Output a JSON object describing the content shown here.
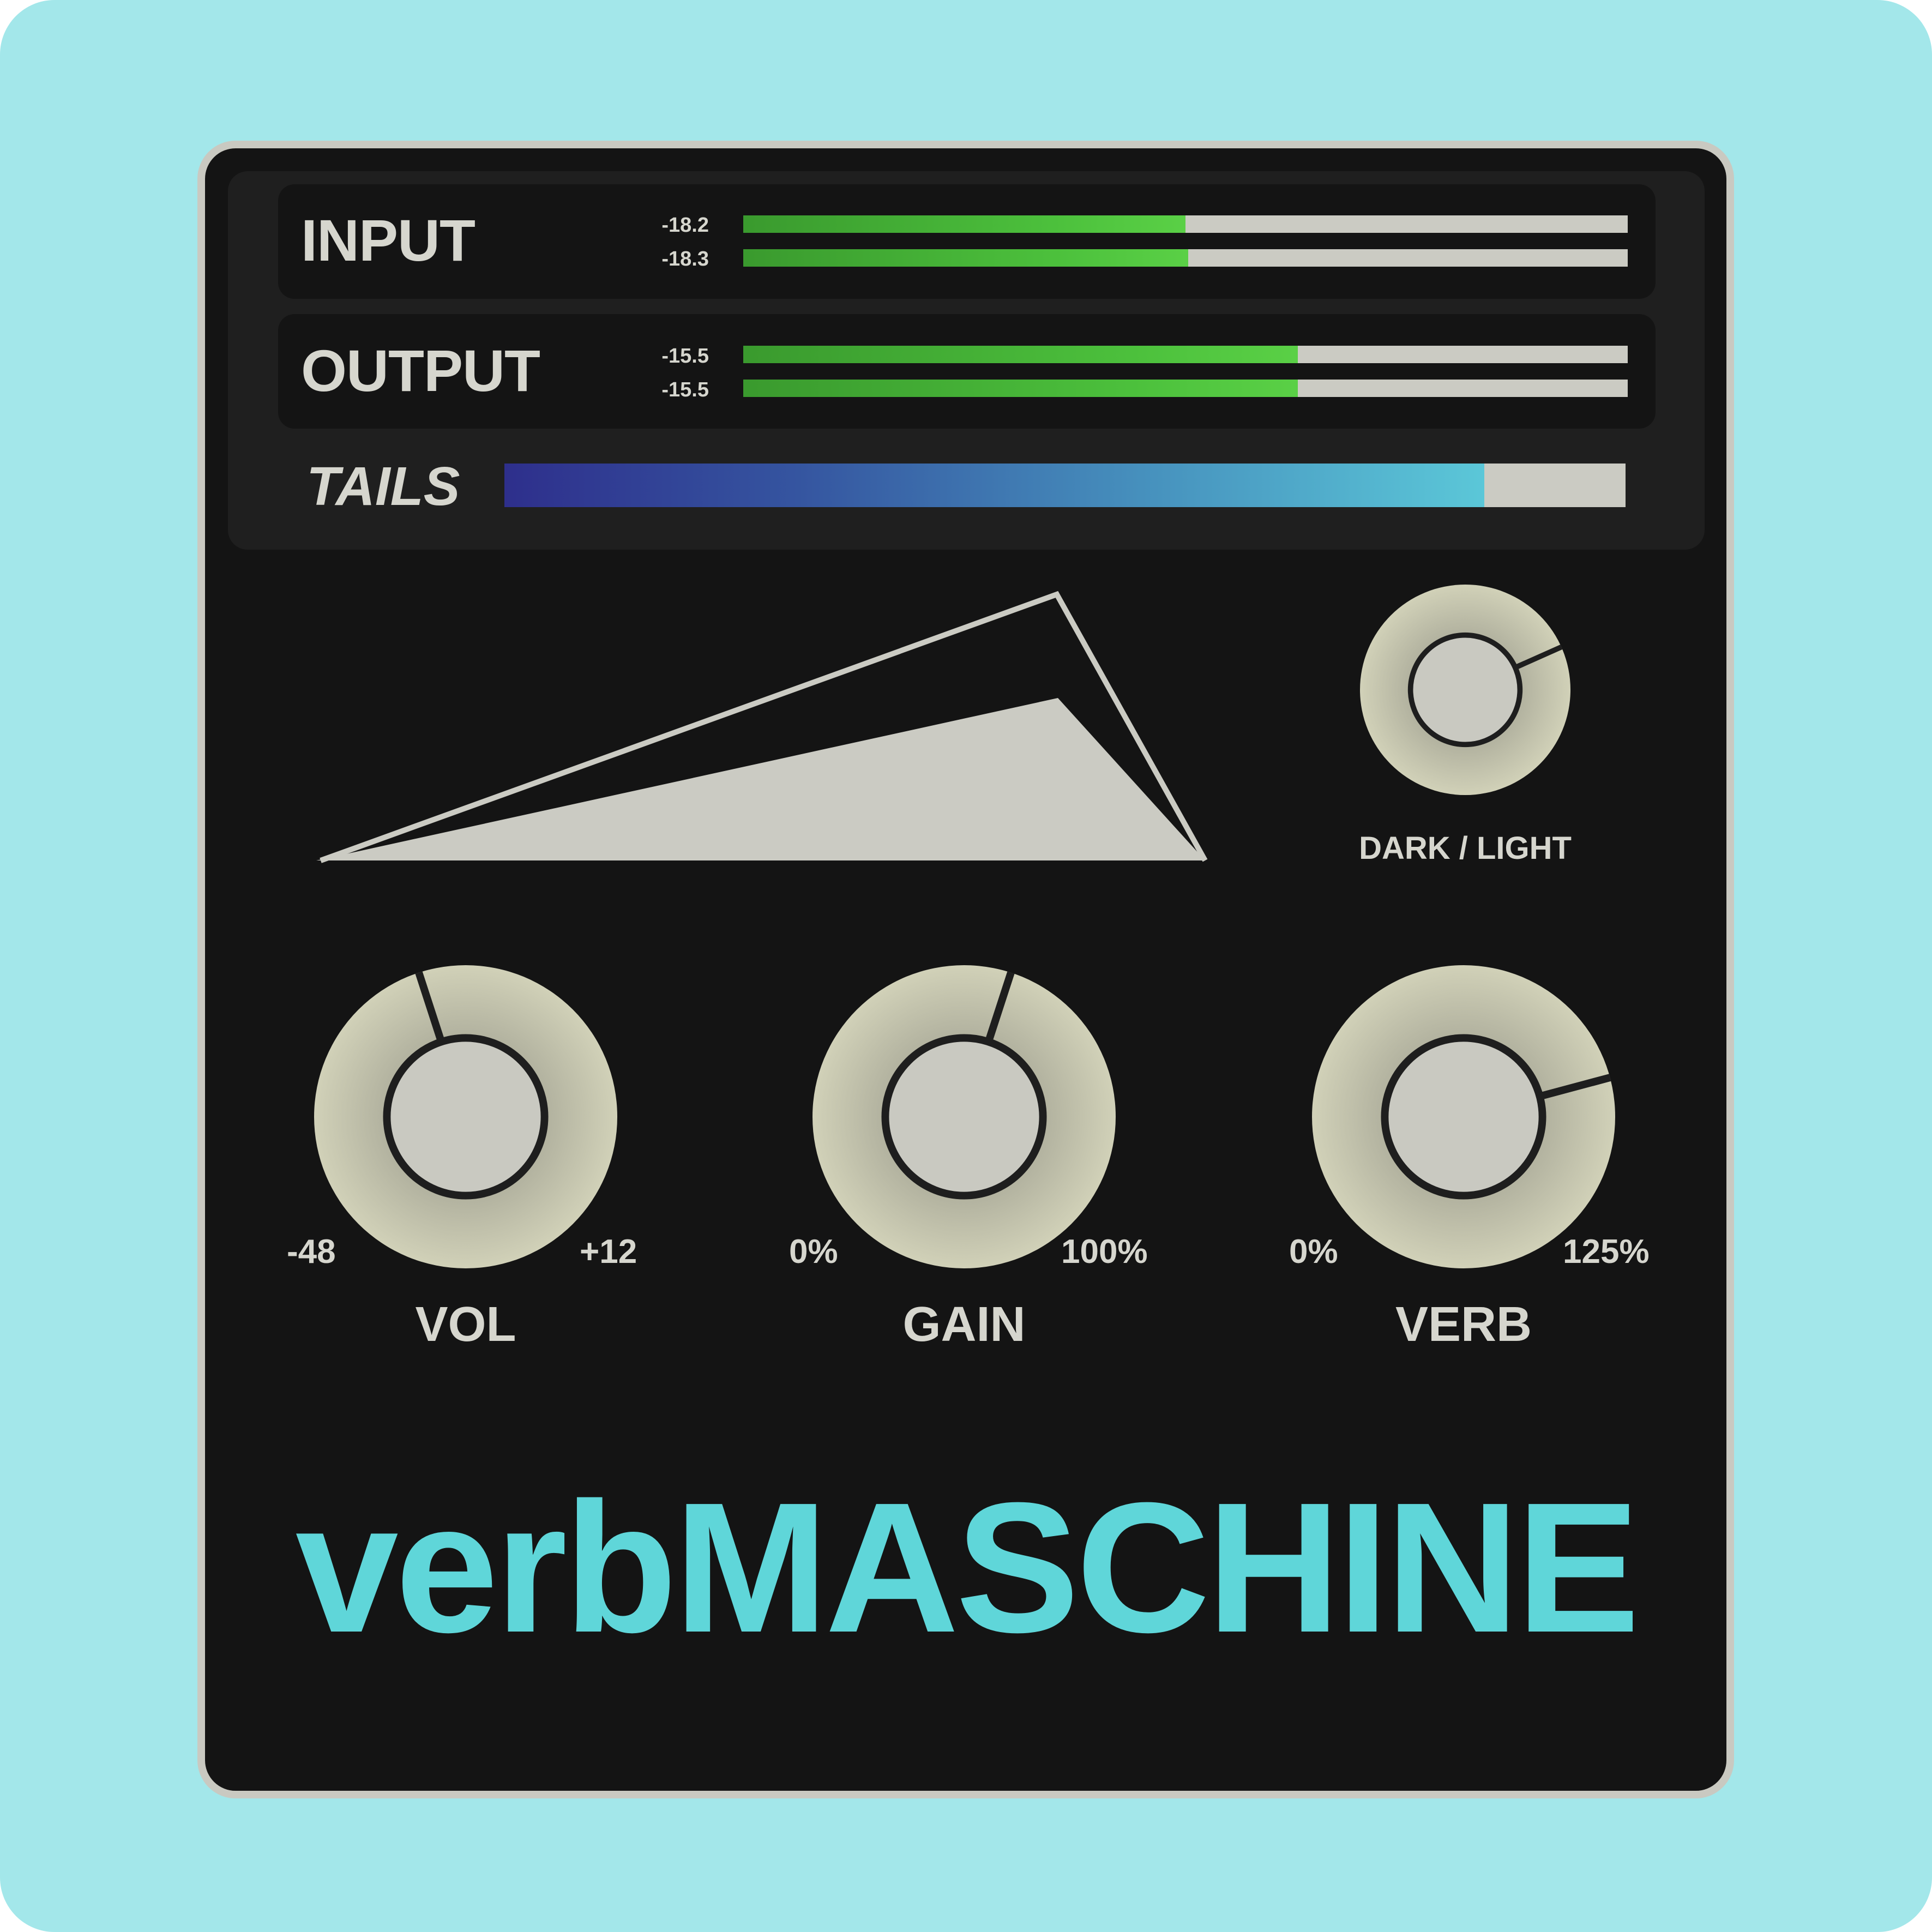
{
  "plugin": {
    "brand_title": "verbMASCHINE",
    "accent_color": "#5fd6d9",
    "background_color": "#a3e7ea"
  },
  "meters": {
    "input": {
      "label": "INPUT",
      "channels": [
        {
          "db_label": "-18.2",
          "level": 0.5
        },
        {
          "db_label": "-18.3",
          "level": 0.503
        }
      ]
    },
    "output": {
      "label": "OUTPUT",
      "channels": [
        {
          "db_label": "-15.5",
          "level": 0.627
        },
        {
          "db_label": "-15.5",
          "level": 0.627
        }
      ]
    },
    "tails": {
      "label": "TAILS",
      "level": 0.874
    }
  },
  "knobs": {
    "dark_light": {
      "label": "DARK / LIGHT",
      "value": 0.72
    },
    "vol": {
      "label": "VOL",
      "min_label": "-48",
      "max_label": "+12",
      "value": 0.44
    },
    "gain": {
      "label": "GAIN",
      "min_label": "0%",
      "max_label": "100%",
      "value": 0.56
    },
    "verb": {
      "label": "VERB",
      "min_label": "0%",
      "max_label": "125%",
      "value": 0.75
    }
  }
}
